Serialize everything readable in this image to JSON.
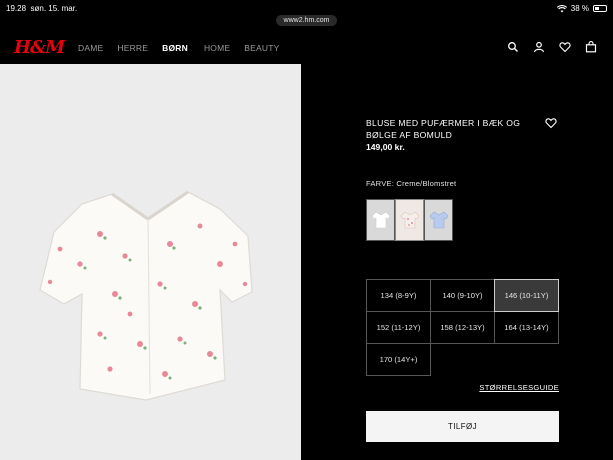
{
  "status": {
    "time": "19.28",
    "date": "søn. 15. mar.",
    "battery": "38 %"
  },
  "browser": {
    "url": "www2.hm.com"
  },
  "header": {
    "logo": "H&M",
    "nav": [
      "DAME",
      "HERRE",
      "BØRN",
      "HOME",
      "BEAUTY"
    ],
    "active_nav": "BØRN",
    "icons": [
      "search-icon",
      "account-icon",
      "heart-icon",
      "bag-icon"
    ]
  },
  "product": {
    "title": "BLUSE MED PUFÆRMER I BÆK OG BØLGE AF BOMULD",
    "price": "149,00 kr.",
    "color_label": "FARVE: Creme/Blomstret",
    "swatches": [
      {
        "name": "white",
        "color": "#ffffff",
        "selected": false
      },
      {
        "name": "creme-floral",
        "color": "#f3e6de",
        "selected": true
      },
      {
        "name": "light-blue",
        "color": "#b8cbee",
        "selected": false
      }
    ],
    "sizes": [
      "134 (8-9Y)",
      "140 (9-10Y)",
      "146 (10-11Y)",
      "152 (11-12Y)",
      "158 (12-13Y)",
      "164 (13-14Y)",
      "170 (14Y+)"
    ],
    "selected_size": "146 (10-11Y)",
    "size_guide": "STØRRELSESGUIDE",
    "add_button": "TILFØJ"
  },
  "colors": {
    "brand": "#e50010",
    "background": "#000000",
    "image_bg": "#ececec"
  }
}
